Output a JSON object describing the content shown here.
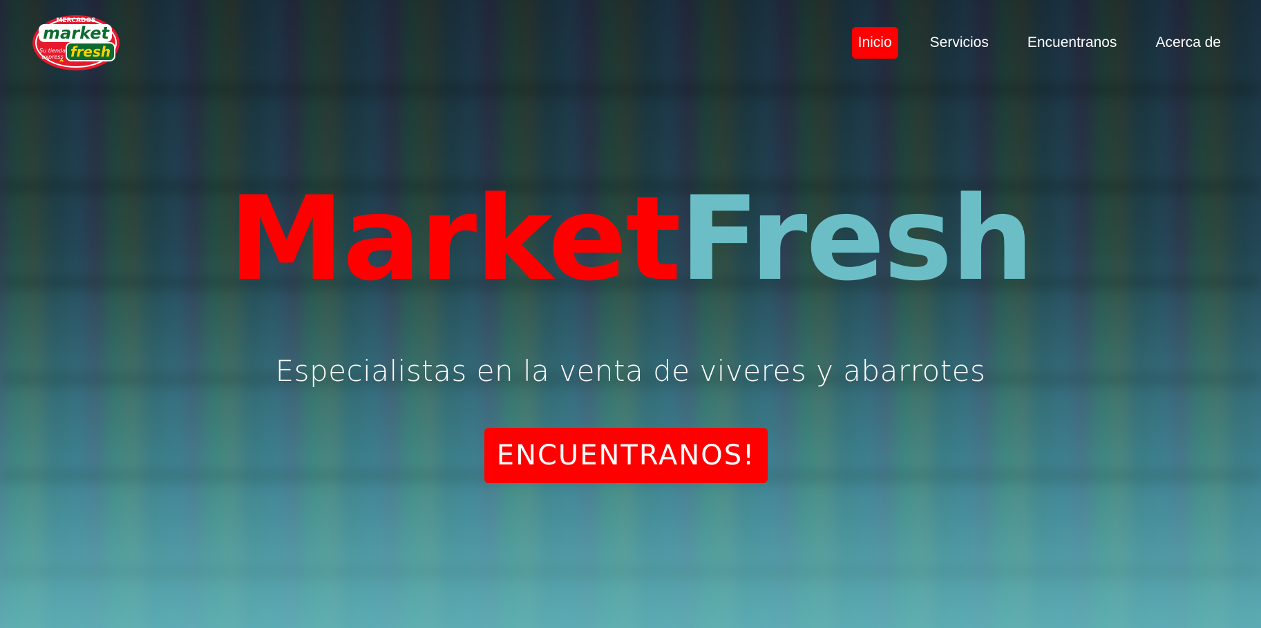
{
  "logo": {
    "alt_text_top": "MERCADOS",
    "word_market": "market",
    "word_fresh": "fresh",
    "tagline_1": "Su tienda",
    "tagline_2": "express",
    "colors": {
      "red": "#e8192c",
      "green": "#0d6b2e",
      "yellow": "#ffd200"
    }
  },
  "nav": {
    "items": [
      {
        "label": "Inicio",
        "active": true
      },
      {
        "label": "Servicios",
        "active": false
      },
      {
        "label": "Encuentranos",
        "active": false
      },
      {
        "label": "Acerca de",
        "active": false
      }
    ]
  },
  "hero": {
    "title_part1": "Market",
    "title_part2": "Fresh",
    "subtitle": "Especialistas en la venta de viveres y abarrotes",
    "cta_label": "ENCUENTRANOS!"
  },
  "colors": {
    "accent_red": "#ff0000",
    "accent_teal": "#6bbec6"
  }
}
